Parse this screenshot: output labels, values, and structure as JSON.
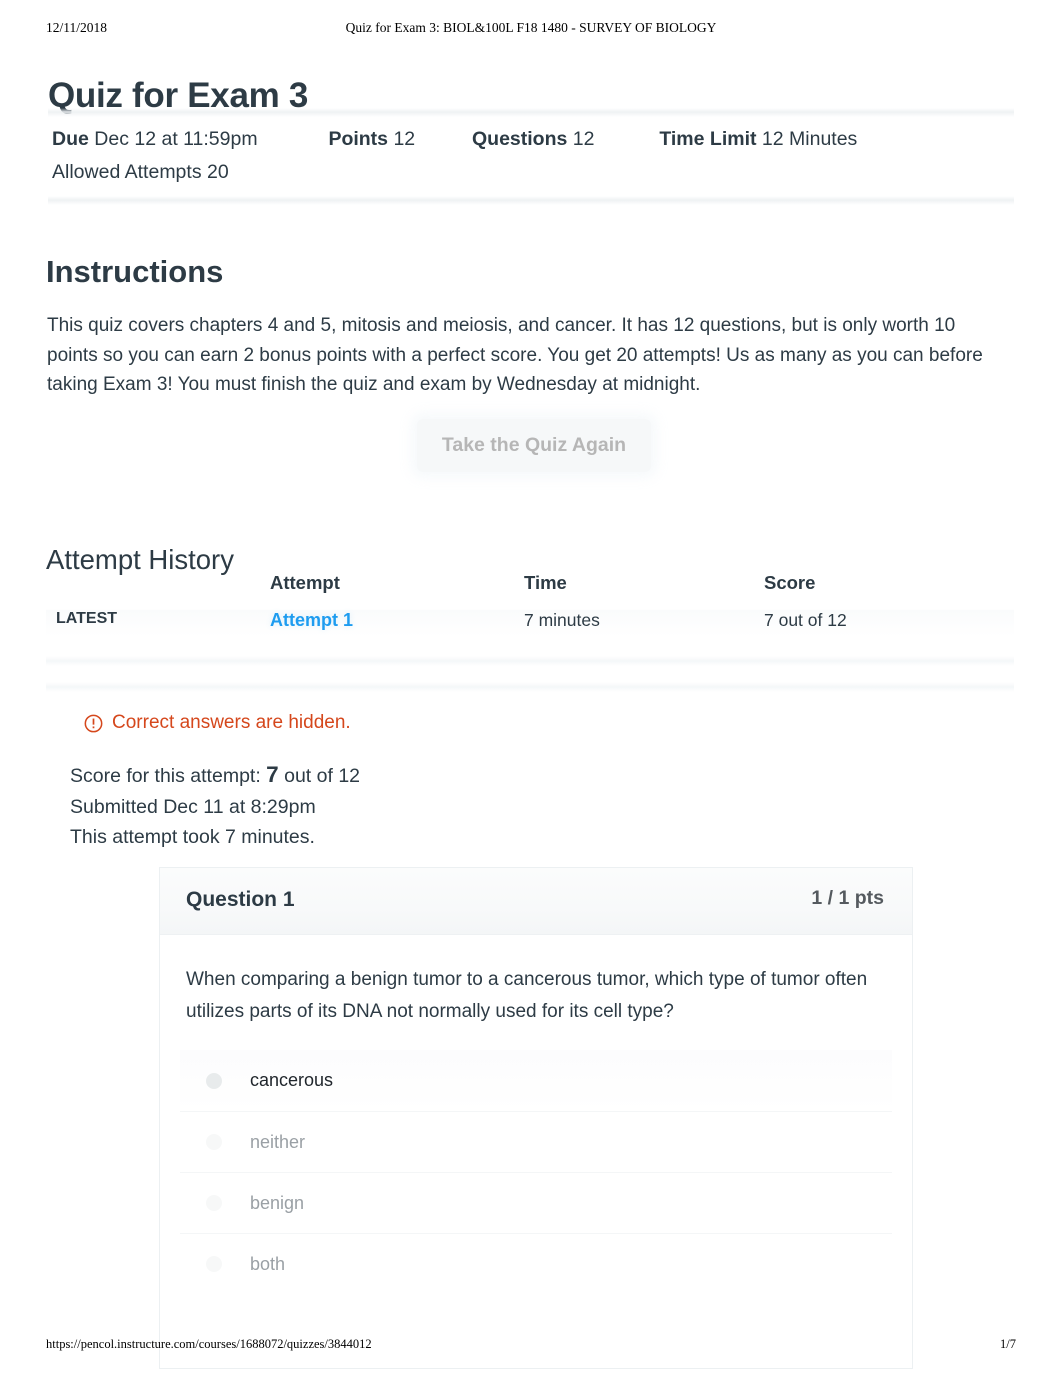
{
  "print": {
    "date": "12/11/2018",
    "doc_title": "Quiz for Exam 3: BIOL&100L F18 1480 - SURVEY OF BIOLOGY",
    "url": "https://pencol.instructure.com/courses/1688072/quizzes/3844012",
    "page_number": "1/7"
  },
  "quiz": {
    "title": "Quiz for Exam 3",
    "meta": {
      "due_label": "Due",
      "due_value": "Dec 12 at 11:59pm",
      "points_label": "Points",
      "points_value": "12",
      "questions_label": "Questions",
      "questions_value": "12",
      "time_limit_label": "Time Limit",
      "time_limit_value": "12 Minutes",
      "attempts_label": "Allowed Attempts",
      "attempts_value": "20"
    }
  },
  "instructions": {
    "heading": "Instructions",
    "body": "This quiz covers chapters 4 and 5, mitosis and meiosis, and cancer. It has 12 questions, but is only worth 10 points  so you can earn 2 bonus points with a perfect score. You get 20 attempts! Us as many as you can before taking Exam 3! You must finish the quiz and exam by Wednesday at midnight."
  },
  "actions": {
    "take_quiz_again": "Take the Quiz Again"
  },
  "attempt_history": {
    "heading": "Attempt History",
    "columns": [
      "",
      "Attempt",
      "Time",
      "Score"
    ],
    "rows": [
      {
        "marker": "LATEST",
        "attempt": "Attempt 1",
        "time": "7 minutes",
        "score": "7 out of 12"
      }
    ]
  },
  "result": {
    "hidden_notice": "Correct answers are hidden.",
    "hidden_notice_icon": "alert-circle-icon",
    "score_prefix": "Score for this attempt:",
    "score_value": "7",
    "score_suffix": "out of 12",
    "submitted": "Submitted Dec 11 at 8:29pm",
    "duration": "This attempt took 7 minutes."
  },
  "question": {
    "number_label": "Question 1",
    "points_label": "1 / 1 pts",
    "text": "When comparing a benign tumor to a cancerous tumor, which type of tumor often utilizes parts of its DNA not normally used for its cell type?",
    "answers": [
      {
        "label": "cancerous",
        "selected": true
      },
      {
        "label": "neither",
        "selected": false
      },
      {
        "label": "benign",
        "selected": false
      },
      {
        "label": "both",
        "selected": false
      }
    ]
  },
  "colors": {
    "link": "#1e9cf0",
    "warning": "#d5471c",
    "text": "#2d3b45",
    "muted": "#9aa0a5"
  }
}
